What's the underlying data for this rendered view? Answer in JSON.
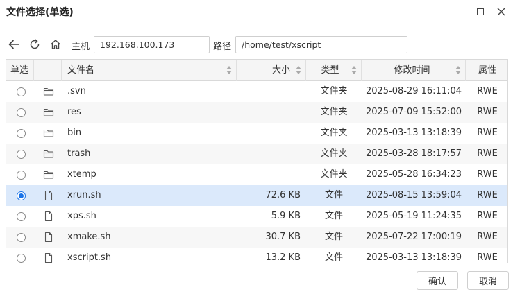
{
  "dialog": {
    "title": "文件选择(单选)"
  },
  "toolbar": {
    "host_label": "主机",
    "host_value": "192.168.100.173",
    "path_label": "路径",
    "path_value": "/home/test/xscript"
  },
  "table": {
    "columns": {
      "select": "单选",
      "name": "文件名",
      "size": "大小",
      "type": "类型",
      "modified": "修改时间",
      "attr": "属性"
    },
    "rows": [
      {
        "name": ".svn",
        "size": "",
        "type": "文件夹",
        "modified": "2025-08-29 16:11:04",
        "attr": "RWE",
        "icon": "folder-icon",
        "selected": false
      },
      {
        "name": "res",
        "size": "",
        "type": "文件夹",
        "modified": "2025-07-09 15:52:00",
        "attr": "RWE",
        "icon": "folder-icon",
        "selected": false
      },
      {
        "name": "bin",
        "size": "",
        "type": "文件夹",
        "modified": "2025-03-13 13:18:39",
        "attr": "RWE",
        "icon": "folder-icon",
        "selected": false
      },
      {
        "name": "trash",
        "size": "",
        "type": "文件夹",
        "modified": "2025-03-28 18:17:57",
        "attr": "RWE",
        "icon": "folder-icon",
        "selected": false
      },
      {
        "name": "xtemp",
        "size": "",
        "type": "文件夹",
        "modified": "2025-05-28 16:34:23",
        "attr": "RWE",
        "icon": "folder-icon",
        "selected": false
      },
      {
        "name": "xrun.sh",
        "size": "72.6 KB",
        "type": "文件",
        "modified": "2025-08-15 13:59:04",
        "attr": "RWE",
        "icon": "file-icon",
        "selected": true
      },
      {
        "name": "xps.sh",
        "size": "5.9 KB",
        "type": "文件",
        "modified": "2025-05-19 11:24:35",
        "attr": "RWE",
        "icon": "file-icon",
        "selected": false
      },
      {
        "name": "xmake.sh",
        "size": "30.7 KB",
        "type": "文件",
        "modified": "2025-07-22 17:00:19",
        "attr": "RWE",
        "icon": "file-icon",
        "selected": false
      },
      {
        "name": "xscript.sh",
        "size": "13.2 KB",
        "type": "文件",
        "modified": "2025-03-13 13:18:39",
        "attr": "RWE",
        "icon": "file-icon",
        "selected": false
      }
    ]
  },
  "footer": {
    "ok_label": "确认",
    "cancel_label": "取消"
  },
  "colors": {
    "selected_row": "#dbe9fb",
    "radio_accent": "#1a73e8"
  }
}
